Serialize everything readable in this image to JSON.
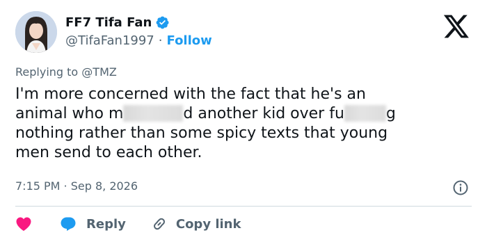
{
  "author": {
    "display_name": "FF7 Tifa Fan",
    "handle": "@TifaFan1997",
    "separator": "·",
    "follow_label": "Follow",
    "verified_icon": "verified-badge-icon"
  },
  "reply_context": {
    "prefix": "Replying to",
    "mention": "@TMZ"
  },
  "tweet": {
    "line1": "I'm more concerned with the fact that he's an",
    "line2_a": "animal who m",
    "line2_b": "d another kid over fu",
    "line2_c": "g",
    "line3": "nothing rather than some spicy texts that young",
    "line4": "men send to each other."
  },
  "timestamp": "7:15 PM · Sep 8, 2026",
  "actions": {
    "reply_label": "Reply",
    "copy_link_label": "Copy link"
  },
  "colors": {
    "accent": "#1d9bf0",
    "like": "#f91880",
    "muted": "#536471",
    "text": "#0f1419"
  },
  "icons": [
    "verified-badge-icon",
    "x-logo-icon",
    "info-icon",
    "heart-icon",
    "reply-bubble-icon",
    "link-icon"
  ]
}
